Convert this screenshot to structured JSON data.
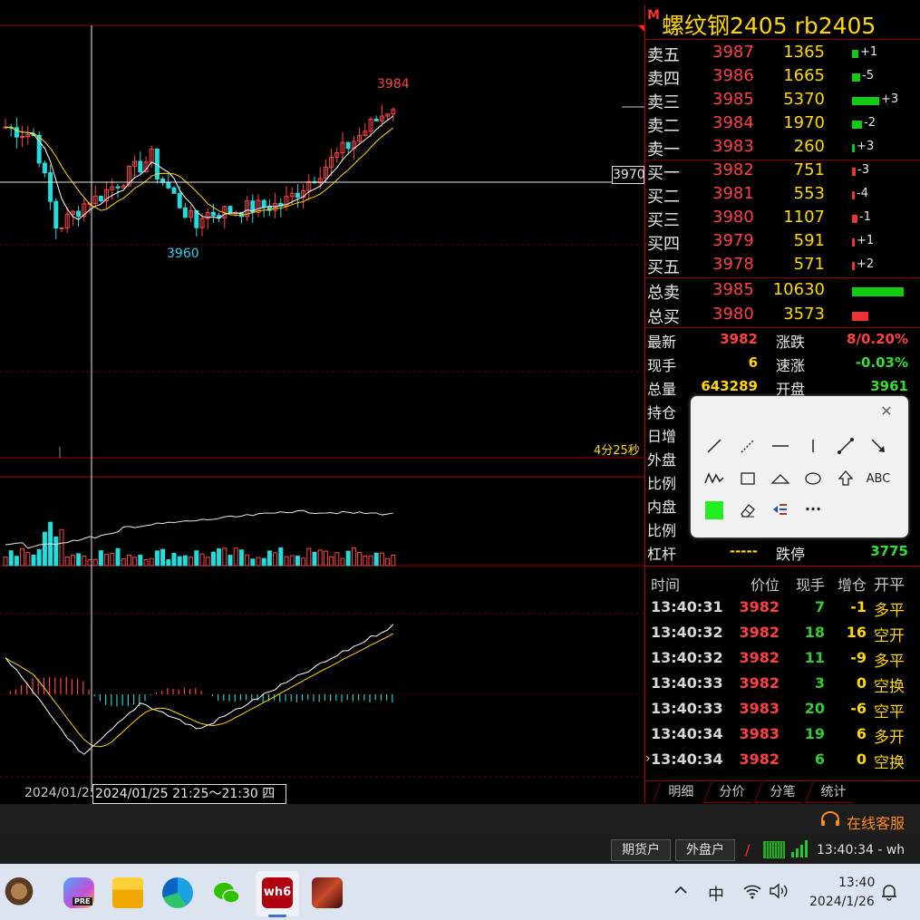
{
  "symbol": {
    "badge": "M",
    "title": "螺纹钢2405  rb2405"
  },
  "chart": {
    "high_label": "3984",
    "low_label": "3960",
    "crosshair_price": "3970",
    "countdown": "4分25秒",
    "date_axis_label": "2024/01/25",
    "crosshair_date": "2024/01/25 21:25～21:30 四"
  },
  "order_book": {
    "asks": [
      {
        "label": "卖五",
        "price": "3987",
        "volume": "1365",
        "change": "+1",
        "bar_color": "#11cc11",
        "bar_fill": 0.12
      },
      {
        "label": "卖四",
        "price": "3986",
        "volume": "1665",
        "change": "-5",
        "bar_color": "#11cc11",
        "bar_fill": 0.15
      },
      {
        "label": "卖三",
        "price": "3985",
        "volume": "5370",
        "change": "+3",
        "bar_color": "#11cc11",
        "bar_fill": 0.5
      },
      {
        "label": "卖二",
        "price": "3984",
        "volume": "1970",
        "change": "-2",
        "bar_color": "#11cc11",
        "bar_fill": 0.18
      },
      {
        "label": "卖一",
        "price": "3983",
        "volume": "260",
        "change": "+3",
        "bar_color": "#11cc11",
        "bar_fill": 0.03
      }
    ],
    "bids": [
      {
        "label": "买一",
        "price": "3982",
        "volume": "751",
        "change": "-3",
        "bar_color": "#ee3333",
        "bar_fill": 0.07
      },
      {
        "label": "买二",
        "price": "3981",
        "volume": "553",
        "change": "-4",
        "bar_color": "#ee3333",
        "bar_fill": 0.05
      },
      {
        "label": "买三",
        "price": "3980",
        "volume": "1107",
        "change": "-1",
        "bar_color": "#ee3333",
        "bar_fill": 0.1
      },
      {
        "label": "买四",
        "price": "3979",
        "volume": "591",
        "change": "+1",
        "bar_color": "#ee3333",
        "bar_fill": 0.05
      },
      {
        "label": "买五",
        "price": "3978",
        "volume": "571",
        "change": "+2",
        "bar_color": "#ee3333",
        "bar_fill": 0.05
      }
    ],
    "totals": [
      {
        "label": "总卖",
        "price": "3985",
        "volume": "10630",
        "bar_color": "#11cc11",
        "bar_fill": 0.95
      },
      {
        "label": "总买",
        "price": "3980",
        "volume": "3573",
        "bar_color": "#ee3333",
        "bar_fill": 0.3
      }
    ]
  },
  "stats": [
    {
      "l1": "最新",
      "v1": "3982",
      "c1": "#ff4040",
      "l2": "涨跌",
      "v2": "8/0.20%",
      "c2": "#ff4040"
    },
    {
      "l1": "现手",
      "v1": "6",
      "c1": "#ffd700",
      "l2": "速涨",
      "v2": "-0.03%",
      "c2": "#33dd33"
    },
    {
      "l1": "总量",
      "v1": "643289",
      "c1": "#ffd700",
      "l2": "开盘",
      "v2": "3961",
      "c2": "#33dd33"
    },
    {
      "l1": "持仓",
      "v1": "",
      "c1": "#ffd700",
      "l2": "",
      "v2": "",
      "c2": "#ff4040"
    },
    {
      "l1": "日增",
      "v1": "",
      "c1": "#ffd700",
      "l2": "",
      "v2": "",
      "c2": "#33dd33"
    },
    {
      "l1": "外盘",
      "v1": "",
      "c1": "#ffd700",
      "l2": "",
      "v2": "",
      "c2": "#33dd33"
    },
    {
      "l1": "比例",
      "v1": "",
      "c1": "#ffd700",
      "l2": "",
      "v2": "",
      "c2": "#33dd33"
    },
    {
      "l1": "内盘",
      "v1": "",
      "c1": "#ffd700",
      "l2": "",
      "v2": "",
      "c2": "#33dd33"
    },
    {
      "l1": "比例",
      "v1": "",
      "c1": "#ffd700",
      "l2": "",
      "v2": "",
      "c2": "#ff4040"
    },
    {
      "l1": "杠杆",
      "v1": "-----",
      "c1": "#ffd700",
      "l2": "跌停",
      "v2": "3775",
      "c2": "#33dd33"
    }
  ],
  "trades_header": {
    "time": "时间",
    "price": "价位",
    "vol": "现手",
    "oi": "增仓",
    "type": "开平"
  },
  "trades": [
    {
      "time": "13:40:31",
      "price": "3982",
      "vol": "7",
      "oi": "-1",
      "type": "多平",
      "price_color": "#ff4040"
    },
    {
      "time": "13:40:32",
      "price": "3982",
      "vol": "18",
      "oi": "16",
      "type": "空开",
      "price_color": "#ff4040"
    },
    {
      "time": "13:40:32",
      "price": "3982",
      "vol": "11",
      "oi": "-9",
      "type": "多平",
      "price_color": "#ff4040"
    },
    {
      "time": "13:40:33",
      "price": "3982",
      "vol": "3",
      "oi": "0",
      "type": "空换",
      "price_color": "#ff4040"
    },
    {
      "time": "13:40:33",
      "price": "3983",
      "vol": "20",
      "oi": "-6",
      "type": "空平",
      "price_color": "#ff4040"
    },
    {
      "time": "13:40:34",
      "price": "3983",
      "vol": "19",
      "oi": "6",
      "type": "多开",
      "price_color": "#ff4040"
    },
    {
      "time": "13:40:34",
      "price": "3982",
      "vol": "6",
      "oi": "0",
      "type": "空换",
      "price_color": "#ff4040"
    }
  ],
  "tabs": [
    "明细",
    "分价",
    "分笔",
    "统计"
  ],
  "drawing_tools": {
    "close": "✕",
    "text_tool": "ABC",
    "more": "···",
    "selected_color": "#22ee22"
  },
  "status": {
    "service": "在线客服",
    "btn_futures": "期货户",
    "btn_foreign": "外盘户",
    "clock_status": "13:40:34 - wh"
  },
  "taskbar": {
    "ime": "中",
    "time": "13:40",
    "date": "2024/1/26",
    "pre_badge": "PRE"
  }
}
